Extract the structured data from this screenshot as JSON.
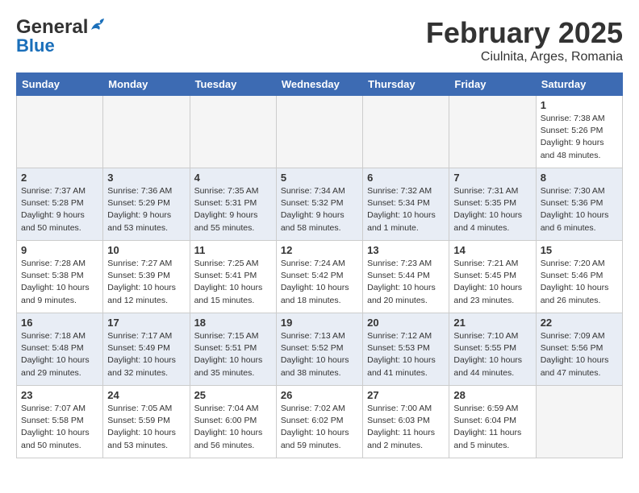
{
  "header": {
    "logo_general": "General",
    "logo_blue": "Blue",
    "month_year": "February 2025",
    "location": "Ciulnita, Arges, Romania"
  },
  "days_of_week": [
    "Sunday",
    "Monday",
    "Tuesday",
    "Wednesday",
    "Thursday",
    "Friday",
    "Saturday"
  ],
  "weeks": [
    {
      "row_class": "row-light",
      "days": [
        {
          "num": "",
          "info": "",
          "empty": true
        },
        {
          "num": "",
          "info": "",
          "empty": true
        },
        {
          "num": "",
          "info": "",
          "empty": true
        },
        {
          "num": "",
          "info": "",
          "empty": true
        },
        {
          "num": "",
          "info": "",
          "empty": true
        },
        {
          "num": "",
          "info": "",
          "empty": true
        },
        {
          "num": "1",
          "info": "Sunrise: 7:38 AM\nSunset: 5:26 PM\nDaylight: 9 hours\nand 48 minutes.",
          "empty": false
        }
      ]
    },
    {
      "row_class": "row-dark",
      "days": [
        {
          "num": "2",
          "info": "Sunrise: 7:37 AM\nSunset: 5:28 PM\nDaylight: 9 hours\nand 50 minutes.",
          "empty": false
        },
        {
          "num": "3",
          "info": "Sunrise: 7:36 AM\nSunset: 5:29 PM\nDaylight: 9 hours\nand 53 minutes.",
          "empty": false
        },
        {
          "num": "4",
          "info": "Sunrise: 7:35 AM\nSunset: 5:31 PM\nDaylight: 9 hours\nand 55 minutes.",
          "empty": false
        },
        {
          "num": "5",
          "info": "Sunrise: 7:34 AM\nSunset: 5:32 PM\nDaylight: 9 hours\nand 58 minutes.",
          "empty": false
        },
        {
          "num": "6",
          "info": "Sunrise: 7:32 AM\nSunset: 5:34 PM\nDaylight: 10 hours\nand 1 minute.",
          "empty": false
        },
        {
          "num": "7",
          "info": "Sunrise: 7:31 AM\nSunset: 5:35 PM\nDaylight: 10 hours\nand 4 minutes.",
          "empty": false
        },
        {
          "num": "8",
          "info": "Sunrise: 7:30 AM\nSunset: 5:36 PM\nDaylight: 10 hours\nand 6 minutes.",
          "empty": false
        }
      ]
    },
    {
      "row_class": "row-light",
      "days": [
        {
          "num": "9",
          "info": "Sunrise: 7:28 AM\nSunset: 5:38 PM\nDaylight: 10 hours\nand 9 minutes.",
          "empty": false
        },
        {
          "num": "10",
          "info": "Sunrise: 7:27 AM\nSunset: 5:39 PM\nDaylight: 10 hours\nand 12 minutes.",
          "empty": false
        },
        {
          "num": "11",
          "info": "Sunrise: 7:25 AM\nSunset: 5:41 PM\nDaylight: 10 hours\nand 15 minutes.",
          "empty": false
        },
        {
          "num": "12",
          "info": "Sunrise: 7:24 AM\nSunset: 5:42 PM\nDaylight: 10 hours\nand 18 minutes.",
          "empty": false
        },
        {
          "num": "13",
          "info": "Sunrise: 7:23 AM\nSunset: 5:44 PM\nDaylight: 10 hours\nand 20 minutes.",
          "empty": false
        },
        {
          "num": "14",
          "info": "Sunrise: 7:21 AM\nSunset: 5:45 PM\nDaylight: 10 hours\nand 23 minutes.",
          "empty": false
        },
        {
          "num": "15",
          "info": "Sunrise: 7:20 AM\nSunset: 5:46 PM\nDaylight: 10 hours\nand 26 minutes.",
          "empty": false
        }
      ]
    },
    {
      "row_class": "row-dark",
      "days": [
        {
          "num": "16",
          "info": "Sunrise: 7:18 AM\nSunset: 5:48 PM\nDaylight: 10 hours\nand 29 minutes.",
          "empty": false
        },
        {
          "num": "17",
          "info": "Sunrise: 7:17 AM\nSunset: 5:49 PM\nDaylight: 10 hours\nand 32 minutes.",
          "empty": false
        },
        {
          "num": "18",
          "info": "Sunrise: 7:15 AM\nSunset: 5:51 PM\nDaylight: 10 hours\nand 35 minutes.",
          "empty": false
        },
        {
          "num": "19",
          "info": "Sunrise: 7:13 AM\nSunset: 5:52 PM\nDaylight: 10 hours\nand 38 minutes.",
          "empty": false
        },
        {
          "num": "20",
          "info": "Sunrise: 7:12 AM\nSunset: 5:53 PM\nDaylight: 10 hours\nand 41 minutes.",
          "empty": false
        },
        {
          "num": "21",
          "info": "Sunrise: 7:10 AM\nSunset: 5:55 PM\nDaylight: 10 hours\nand 44 minutes.",
          "empty": false
        },
        {
          "num": "22",
          "info": "Sunrise: 7:09 AM\nSunset: 5:56 PM\nDaylight: 10 hours\nand 47 minutes.",
          "empty": false
        }
      ]
    },
    {
      "row_class": "row-light",
      "days": [
        {
          "num": "23",
          "info": "Sunrise: 7:07 AM\nSunset: 5:58 PM\nDaylight: 10 hours\nand 50 minutes.",
          "empty": false
        },
        {
          "num": "24",
          "info": "Sunrise: 7:05 AM\nSunset: 5:59 PM\nDaylight: 10 hours\nand 53 minutes.",
          "empty": false
        },
        {
          "num": "25",
          "info": "Sunrise: 7:04 AM\nSunset: 6:00 PM\nDaylight: 10 hours\nand 56 minutes.",
          "empty": false
        },
        {
          "num": "26",
          "info": "Sunrise: 7:02 AM\nSunset: 6:02 PM\nDaylight: 10 hours\nand 59 minutes.",
          "empty": false
        },
        {
          "num": "27",
          "info": "Sunrise: 7:00 AM\nSunset: 6:03 PM\nDaylight: 11 hours\nand 2 minutes.",
          "empty": false
        },
        {
          "num": "28",
          "info": "Sunrise: 6:59 AM\nSunset: 6:04 PM\nDaylight: 11 hours\nand 5 minutes.",
          "empty": false
        },
        {
          "num": "",
          "info": "",
          "empty": true
        }
      ]
    }
  ]
}
